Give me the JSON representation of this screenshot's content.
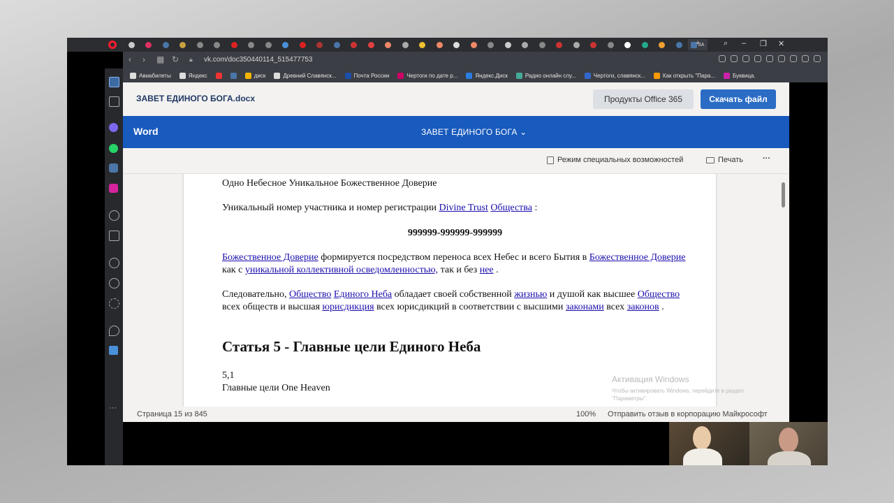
{
  "browser": {
    "url": "vk.com/doc350440114_515477753",
    "active_tab_label": "ЗА",
    "new_tab_symbol": "+",
    "tab_colors": [
      "#c9c9c9",
      "#e03060",
      "#4a76a8",
      "#c9a040",
      "#888",
      "#888",
      "#d22",
      "#888",
      "#888",
      "#4a90d9",
      "#d22",
      "#a33",
      "#4a76a8",
      "#c33",
      "#e04040",
      "#e86",
      "#aaa",
      "#f0c030",
      "#e86",
      "#ddd",
      "#e86",
      "#888",
      "#ccc",
      "#aaa",
      "#888",
      "#c33",
      "#aaa",
      "#c33",
      "#888",
      "#fff",
      "#2a8",
      "#f0a030",
      "#4a76a8"
    ],
    "bookmarks": [
      {
        "label": "Авиабилеты",
        "color": "#ddd"
      },
      {
        "label": "Яндекс",
        "color": "#ddd"
      },
      {
        "label": "",
        "color": "#e33"
      },
      {
        "label": "",
        "color": "#4a76a8"
      },
      {
        "label": "диск",
        "color": "#f4b400"
      },
      {
        "label": "Древний Славянск...",
        "color": "#ddd"
      },
      {
        "label": "Почта России",
        "color": "#1e4fa8"
      },
      {
        "label": "Чертоги по дате р...",
        "color": "#c06"
      },
      {
        "label": "Яндекс.Диск",
        "color": "#2a7de1"
      },
      {
        "label": "Радио онлайн слу...",
        "color": "#4a9"
      },
      {
        "label": "Чертоги, славянск...",
        "color": "#36c"
      },
      {
        "label": "Как открыть \"Пара...",
        "color": "#f90"
      },
      {
        "label": "Буквица.",
        "color": "#c2a"
      }
    ]
  },
  "app": {
    "filename": "ЗАВЕТ ЕДИНОГО БОГА.docx",
    "office_button": "Продукты Office 365",
    "download_button": "Скачать файл",
    "brand": "Word",
    "doc_title": "ЗАВЕТ ЕДИНОГО БОГА",
    "accessibility": "Режим специальных возможностей",
    "print": "Печать",
    "more": "···"
  },
  "document": {
    "p1": "Одно Небесное Уникальное Божественное Доверие",
    "p2_text": "Уникальный номер участника и номер регистрации",
    "p2_link1": "Divine Trust",
    "p2_link2": "Общества",
    "p2_end": ":",
    "number": "999999-999999-999999",
    "p3_link1": "Божественное Доверие",
    "p3_t1": "формируется посредством переноса всех Небес и всего Бытия в",
    "p3_link2": "Божественное Доверие",
    "p3_t2": "как с",
    "p3_link3": "уникальной коллективной осведомленностью,",
    "p3_t3": "так и без",
    "p3_link4": "нее",
    "p3_end": ".",
    "p4_t1": "Следовательно,",
    "p4_link1": "Общество",
    "p4_link2": "Единого Неба",
    "p4_t2": "обладает своей собственной",
    "p4_link3": "жизнью",
    "p4_t3": "и душой как высшее",
    "p4_link4": "Общество",
    "p4_t4": "всех обществ и высшая",
    "p4_link5": "юрисдикция",
    "p4_t5": "всех юрисдикций в соответствии с высшими",
    "p4_link6": "законами",
    "p4_t6": "всех",
    "p4_link7": "законов",
    "p4_end": ".",
    "heading": "Статья 5 - Главные цели Единого Неба",
    "sec_num": "5,1",
    "sec_text": "Главные цели One Heaven"
  },
  "watermark": {
    "title": "Активация Windows",
    "text": "Чтобы активировать Windows, перейдите в раздел \"Параметры\"."
  },
  "status": {
    "page": "Страница 15 из 845",
    "zoom": "100%",
    "feedback": "Отправить отзыв в корпорацию Майкрософт"
  }
}
